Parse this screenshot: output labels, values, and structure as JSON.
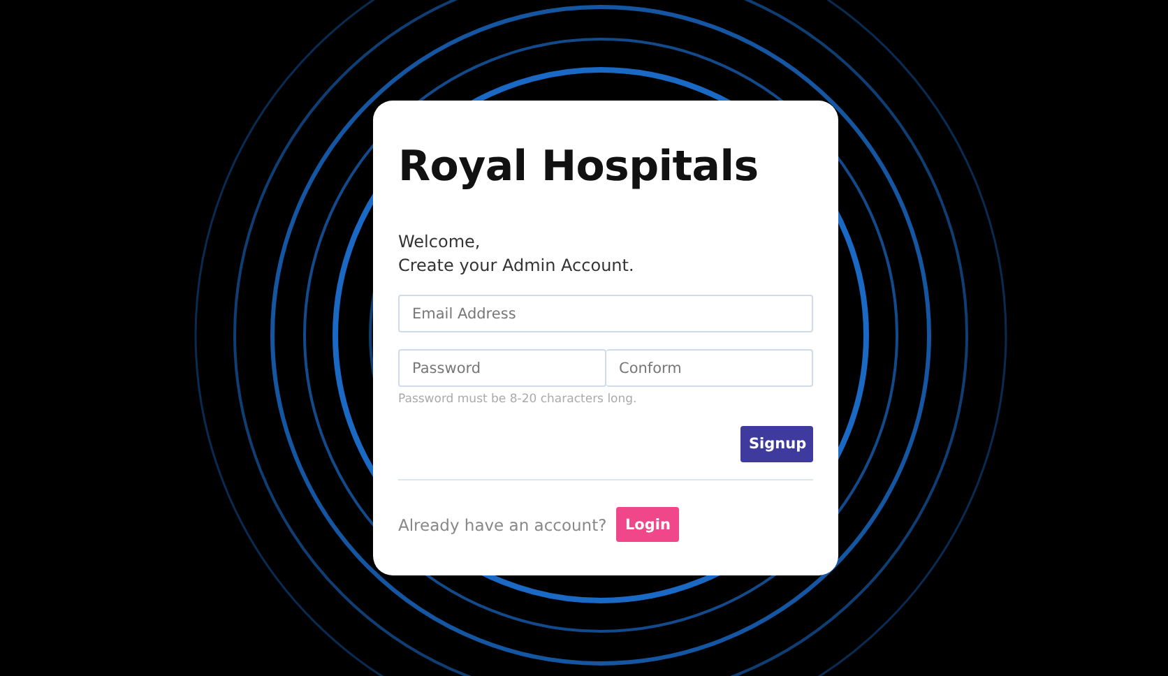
{
  "card": {
    "title": "Royal Hospitals",
    "greeting": "Welcome,",
    "subtitle": "Create your Admin Account.",
    "email": {
      "placeholder": "Email Address"
    },
    "password": {
      "placeholder": "Password"
    },
    "confirm": {
      "placeholder": "Conform"
    },
    "hint": "Password must be 8-20 characters long.",
    "signup_button": "Signup",
    "login_prompt": "Already have an account?",
    "login_button": "Login"
  }
}
